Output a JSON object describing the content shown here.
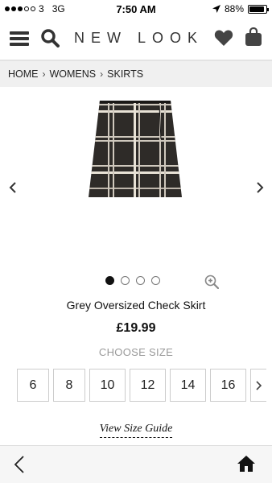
{
  "status_bar": {
    "carrier": "3",
    "network": "3G",
    "time": "7:50 AM",
    "battery": "88%",
    "battery_level": 0.88,
    "signal_bars_filled": 3,
    "signal_bars_total": 5
  },
  "header": {
    "brand": "NEW LOOK",
    "icons": [
      "menu-icon",
      "search-icon",
      "heart-icon",
      "bag-icon"
    ]
  },
  "breadcrumb": {
    "items": [
      "HOME",
      "WOMENS",
      "SKIRTS"
    ]
  },
  "product": {
    "title": "Grey Oversized Check Skirt",
    "price": "£19.99",
    "image_count": 4,
    "active_image": 0
  },
  "size_selector": {
    "label": "CHOOSE SIZE",
    "sizes": [
      "6",
      "8",
      "10",
      "12",
      "14",
      "16"
    ],
    "guide_label": "View Size Guide"
  },
  "toolbar": {
    "icons": [
      "back-icon",
      "home-icon"
    ]
  },
  "colors": {
    "accent": "#111111",
    "muted": "#999999",
    "breadcrumb_bg": "#f0f0f0",
    "toolbar_bg": "#f6f6f6"
  }
}
